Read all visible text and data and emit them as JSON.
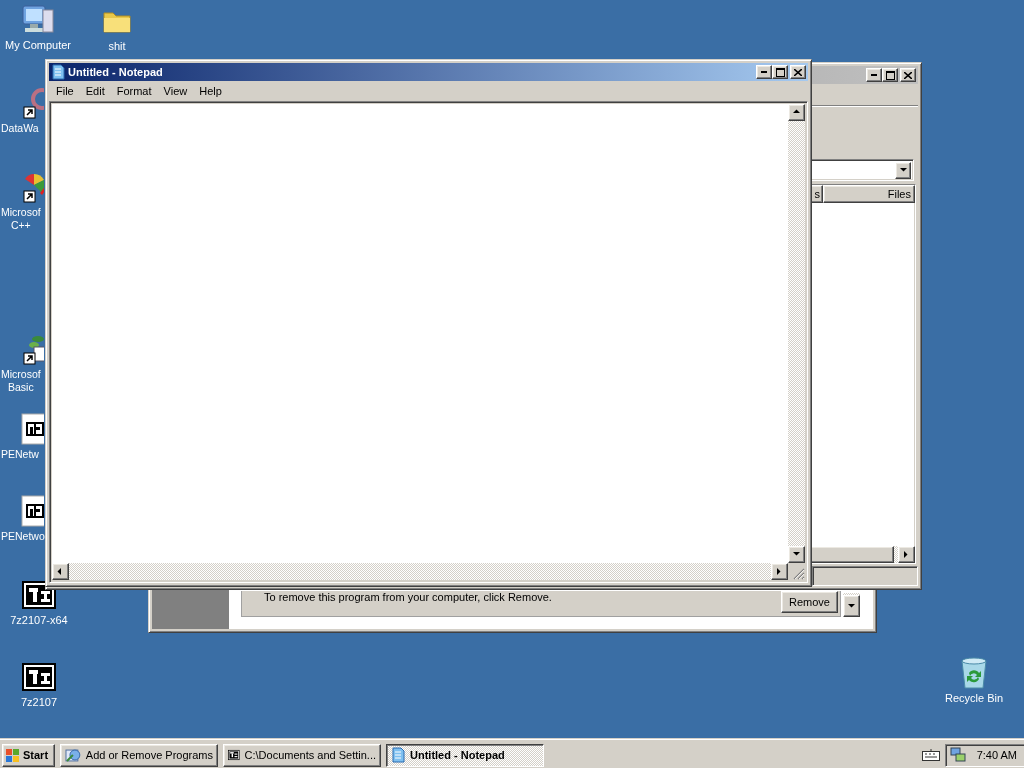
{
  "desktop_icons": [
    {
      "label": "My Computer",
      "kind": "computer"
    },
    {
      "label": "shit",
      "kind": "folder"
    },
    {
      "label": "DataWa",
      "kind": "datawag"
    },
    {
      "label": "Microsof\nC++",
      "kind": "vcpp"
    },
    {
      "label": "Microsof\nBasic",
      "kind": "vbasic"
    },
    {
      "label": "PENetw",
      "kind": "archive-doc"
    },
    {
      "label": "PENetwo",
      "kind": "archive-doc"
    },
    {
      "label": "7z2107-x64",
      "kind": "archive"
    },
    {
      "label": "7z2107",
      "kind": "archive"
    },
    {
      "label": "Recycle Bin",
      "kind": "recycle"
    }
  ],
  "add_remove_window": {
    "description": "To remove this program from your computer, click Remove.",
    "button": "Remove"
  },
  "explorer_window": {
    "active": false,
    "columns": [
      "s",
      "Files"
    ]
  },
  "notepad": {
    "title": "Untitled - Notepad",
    "active": true,
    "menu": [
      "File",
      "Edit",
      "Format",
      "View",
      "Help"
    ]
  },
  "taskbar": {
    "start": "Start",
    "tasks": [
      {
        "label": "Add or Remove Programs",
        "kind": "control-panel",
        "selected": false
      },
      {
        "label": "C:\\Documents and Settin...",
        "kind": "archive",
        "selected": false
      },
      {
        "label": "Untitled - Notepad",
        "kind": "notepad",
        "selected": true
      }
    ],
    "clock": "7:40 AM"
  }
}
